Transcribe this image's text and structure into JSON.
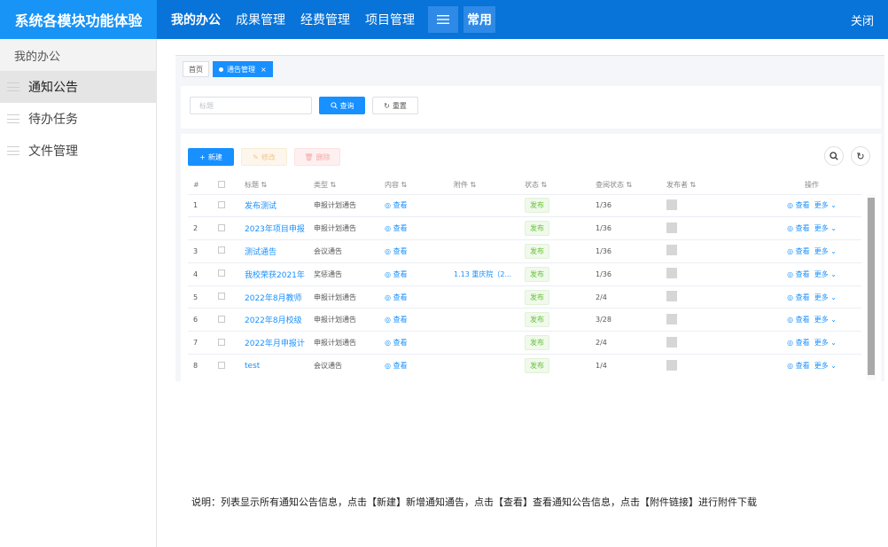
{
  "header": {
    "brand": "系统各模块功能体验",
    "nav": [
      "我的办公",
      "成果管理",
      "经费管理",
      "项目管理"
    ],
    "common": "常用",
    "close": "关闭"
  },
  "sidebar": {
    "heading": "我的办公",
    "items": [
      "通知公告",
      "待办任务",
      "文件管理"
    ]
  },
  "frame": {
    "tabs": [
      "首页",
      "通告管理"
    ],
    "tab_close": "×",
    "search_placeholder": "标题",
    "query_label": "查询",
    "reset_label": "重置",
    "new_label": "新建",
    "edit_label": "修改",
    "delete_label": "删除",
    "columns": [
      "#",
      "标题",
      "类型",
      "内容",
      "附件",
      "状态",
      "查阅状态",
      "发布者",
      "操作"
    ],
    "view_label": "查看",
    "more_label": "更多",
    "rows": [
      {
        "no": "1",
        "title": "发布测试",
        "type": "申报计划通告",
        "attachment": "",
        "status": "发布",
        "read": "1/36"
      },
      {
        "no": "2",
        "title": "2023年项目申报",
        "type": "申报计划通告",
        "attachment": "",
        "status": "发布",
        "read": "1/36"
      },
      {
        "no": "3",
        "title": "测试通告",
        "type": "会议通告",
        "attachment": "",
        "status": "发布",
        "read": "1/36"
      },
      {
        "no": "4",
        "title": "我校荣获2021年",
        "type": "奖惩通告",
        "attachment": "1.13 重庆院（2...",
        "status": "发布",
        "read": "1/36"
      },
      {
        "no": "5",
        "title": "2022年8月教师",
        "type": "申报计划通告",
        "attachment": "",
        "status": "发布",
        "read": "2/4"
      },
      {
        "no": "6",
        "title": "2022年8月校级",
        "type": "申报计划通告",
        "attachment": "",
        "status": "发布",
        "read": "3/28"
      },
      {
        "no": "7",
        "title": "2022年月申报计",
        "type": "申报计划通告",
        "attachment": "",
        "status": "发布",
        "read": "2/4"
      },
      {
        "no": "8",
        "title": "test",
        "type": "会议通告",
        "attachment": "",
        "status": "发布",
        "read": "1/4"
      }
    ]
  },
  "note": "说明：列表显示所有通知公告信息，点击【新建】新增通知通告，点击【查看】查看通知公告信息，点击【附件链接】进行附件下载",
  "colors": {
    "topbar": "#0873d8",
    "brand": "#1893f6",
    "primary": "#1890ff",
    "success": "#67c23a"
  }
}
